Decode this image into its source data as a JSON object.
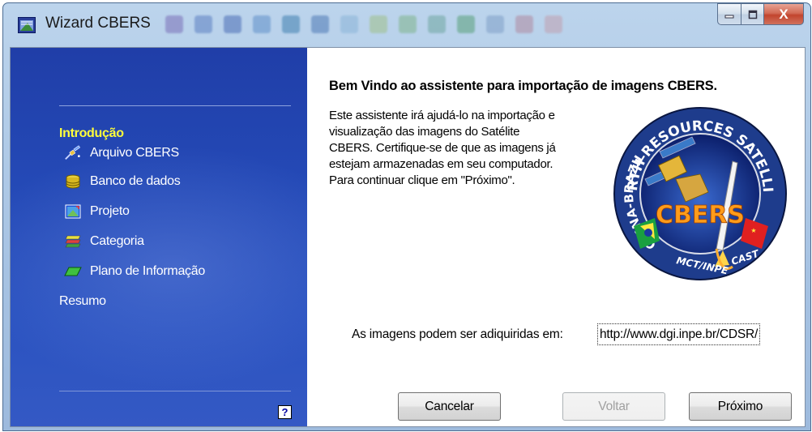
{
  "window": {
    "title": "Wizard CBERS",
    "controls": {
      "minimize_icon": "minimize-icon",
      "maximize_icon": "maximize-icon",
      "close_label": "X"
    }
  },
  "sidebar": {
    "items": [
      {
        "label": "Introdução",
        "icon": null,
        "active": true
      },
      {
        "label": "Arquivo CBERS",
        "icon": "satellite-icon",
        "active": false
      },
      {
        "label": "Banco de dados",
        "icon": "database-icon",
        "active": false
      },
      {
        "label": "Projeto",
        "icon": "project-icon",
        "active": false
      },
      {
        "label": "Categoria",
        "icon": "category-icon",
        "active": false
      },
      {
        "label": "Plano de Informação",
        "icon": "information-plane-icon",
        "active": false
      },
      {
        "label": "Resumo",
        "icon": null,
        "active": false
      }
    ],
    "help_label": "?",
    "active_color": "#ffff3a"
  },
  "content": {
    "heading": "Bem Vindo ao assistente para importação de imagens CBERS.",
    "description_lines": [
      "Este assistente irá ajudá-lo na importação e",
      "visualização das imagens do Satélite",
      "CBERS. Certifique-se de que as imagens já",
      "estejam armazenadas em seu computador.",
      "Para continuar clique em \"Próximo\"."
    ],
    "logo": {
      "top_arc": "EARTH RESOURCES SATELLITE",
      "left_arc": "CHINA-BRAZIL",
      "center": "CBERS",
      "bottom_left": "MCT/INPE",
      "bottom_right": "CAST"
    },
    "download_label": "As imagens podem ser adiquiridas em:",
    "download_link": "http://www.dgi.inpe.br/CDSR/"
  },
  "buttons": {
    "cancel": "Cancelar",
    "back": "Voltar",
    "next": "Próximo"
  }
}
